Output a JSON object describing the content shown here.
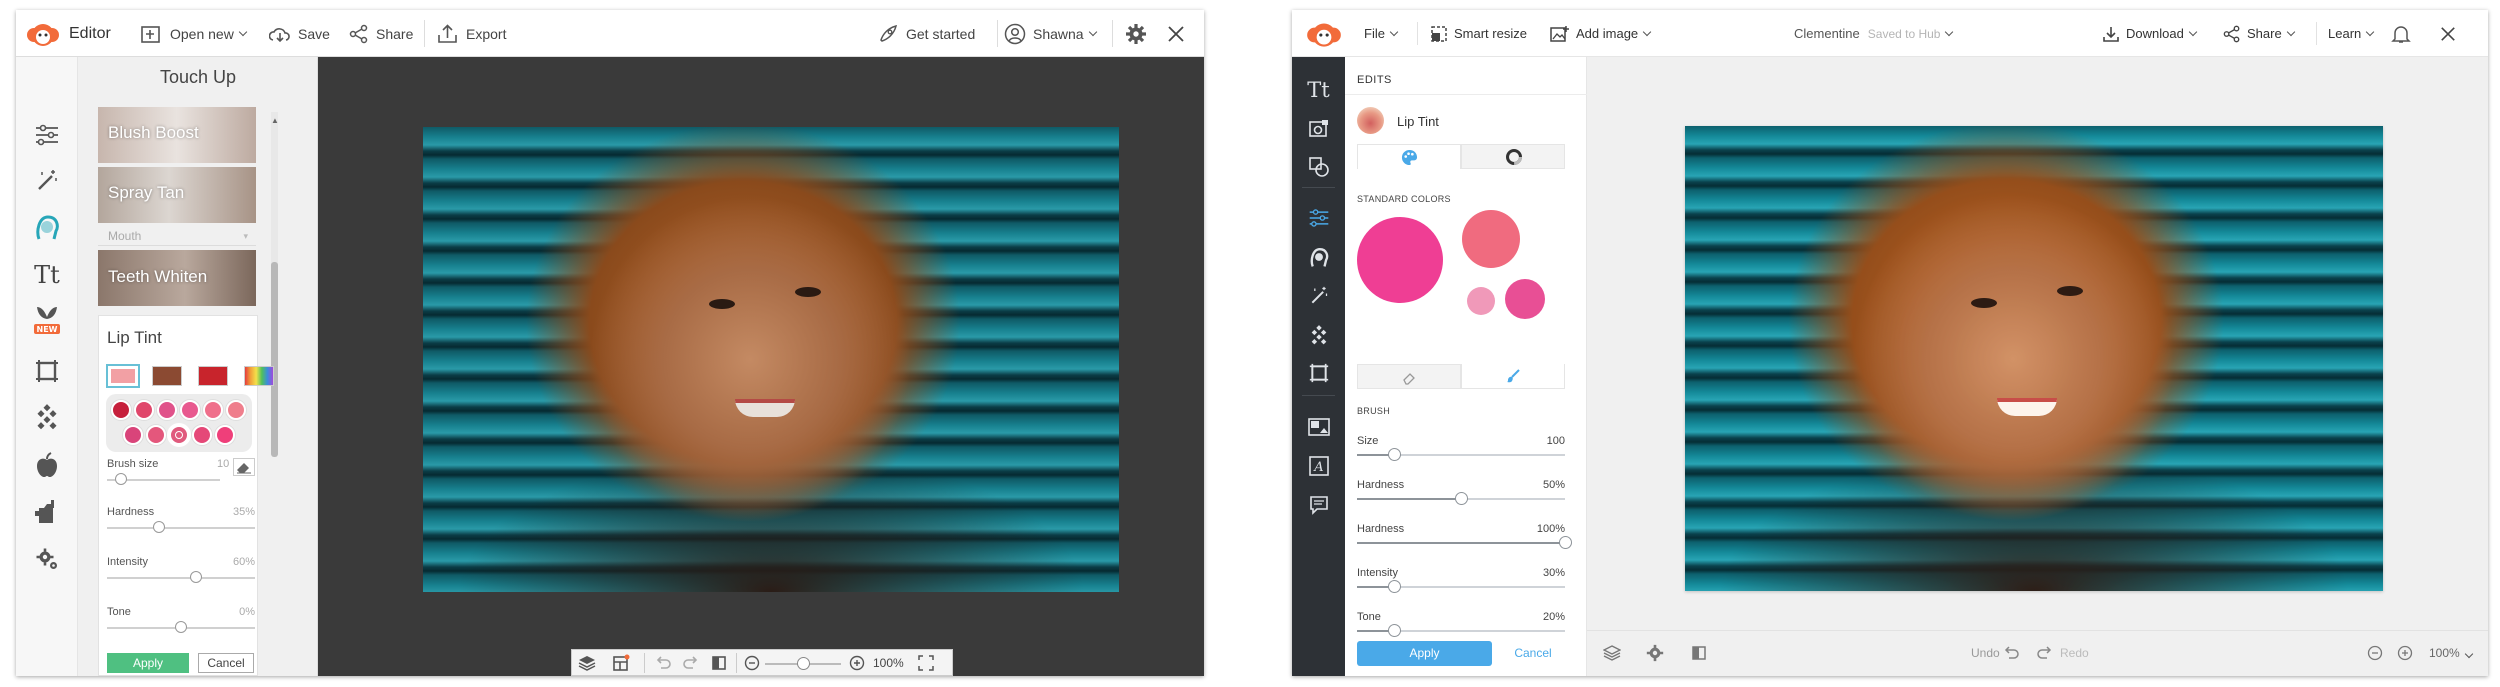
{
  "old_editor": {
    "app_title": "Editor",
    "toolbar": {
      "open_new": "Open new",
      "save": "Save",
      "share": "Share",
      "export": "Export",
      "get_started": "Get started",
      "user": "Shawna"
    },
    "panel": {
      "title": "Touch Up",
      "effects": [
        "Blush Boost",
        "Spray Tan"
      ],
      "section_select": "Mouth",
      "teeth": "Teeth Whiten",
      "tool_title": "Lip Tint",
      "brush_size_label": "Brush size",
      "brush_size_value": "10",
      "sliders": [
        {
          "label": "Hardness",
          "value": "35%",
          "level": 0.35
        },
        {
          "label": "Intensity",
          "value": "60%",
          "level": 0.6
        },
        {
          "label": "Tone",
          "value": "0%",
          "level": 0.5
        }
      ],
      "brush_level": 0.12,
      "apply": "Apply",
      "cancel": "Cancel",
      "presets": [
        "#f2a0a4",
        "#8b4a32",
        "#c8242c",
        "rainbow"
      ],
      "swatches_row1": [
        "#c6203c",
        "#e0476b",
        "#e0528a",
        "#e8598f",
        "#ef6f8b",
        "#ef7e8c"
      ],
      "swatches_row2": [
        "#d9447a",
        "#e4577c",
        "#e05a7d",
        "#e54878",
        "#ef3f7a"
      ]
    },
    "bottom": {
      "zoom": "100%",
      "zoom_level": 0.5
    }
  },
  "new_editor": {
    "toolbar": {
      "file": "File",
      "smart_resize": "Smart resize",
      "add_image": "Add image",
      "doc_name": "Clementine",
      "saved": "Saved to Hub",
      "download": "Download",
      "share": "Share",
      "learn": "Learn"
    },
    "panel": {
      "header": "EDITS",
      "tool": "Lip Tint",
      "standard_colors": "STANDARD COLORS",
      "colors": [
        "#ef3e94",
        "#f06b7f",
        "#f099b9",
        "#e84f95"
      ],
      "brush_header": "BRUSH",
      "sliders": [
        {
          "label": "Size",
          "value": "100",
          "level": 0.18
        },
        {
          "label": "Hardness",
          "value": "50%",
          "level": 0.5
        },
        {
          "label": "Hardness",
          "value": "100%",
          "level": 1.0
        },
        {
          "label": "Intensity",
          "value": "30%",
          "level": 0.18
        },
        {
          "label": "Tone",
          "value": "20%",
          "level": 0.18
        }
      ],
      "apply": "Apply",
      "cancel": "Cancel"
    },
    "bottom": {
      "undo": "Undo",
      "redo": "Redo",
      "zoom": "100%"
    }
  }
}
